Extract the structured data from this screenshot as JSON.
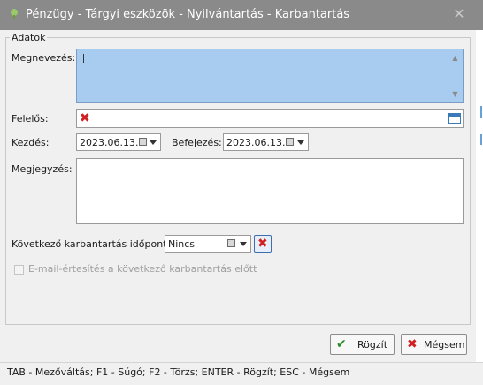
{
  "window": {
    "title": "Pénzügy - Tárgyi eszközök - Nyilvántartás - Karbantartás",
    "close_glyph": "✕",
    "app_icon": "green-leaf-icon"
  },
  "group": {
    "title": "Adatok"
  },
  "form": {
    "name_label": "Megnevezés:",
    "name_value": "",
    "responsible_label": "Felelős:",
    "start_label": "Kezdés:",
    "start_value": "2023.06.13.",
    "end_label": "Befejezés:",
    "end_value": "2023.06.13.",
    "note_label": "Megjegyzés:",
    "note_value": "",
    "next_maint_label": "Következő karbantartás időpontja:",
    "next_maint_value": "Nincs",
    "email_checkbox_label": "E-mail-értesítés a következő karbantartás előtt",
    "email_checkbox_checked": false
  },
  "buttons": {
    "save_label": "Rögzít",
    "cancel_label": "Mégsem"
  },
  "statusbar": {
    "text": "TAB - Mezőváltás; F1 - Súgó; F2 - Törzs; ENTER - Rögzít; ESC - Mégsem"
  },
  "colors": {
    "titlebar": "#8a8a8a",
    "selected_field": "#a8ccf0",
    "error_red": "#d02020",
    "save_check": "#2f8a2f"
  }
}
